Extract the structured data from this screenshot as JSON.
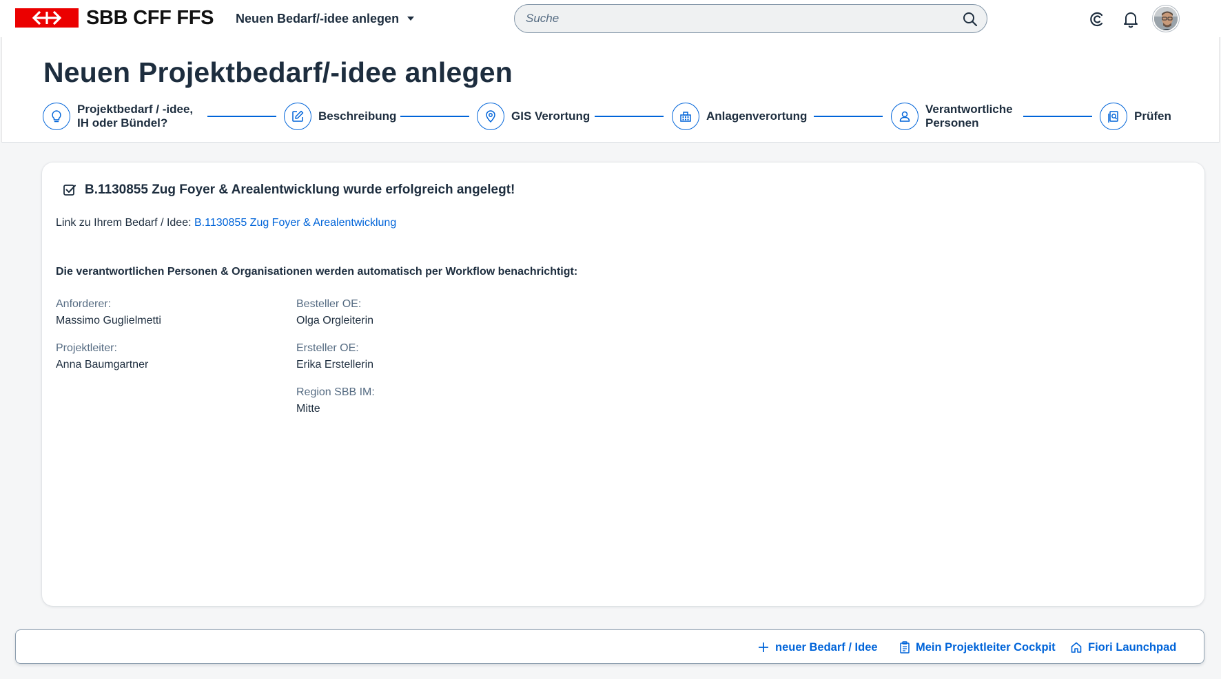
{
  "shell": {
    "brand": "SBB CFF FFS",
    "app_title": "Neuen Bedarf/-idee anlegen",
    "search_placeholder": "Suche"
  },
  "page": {
    "title": "Neuen Projektbedarf/-idee anlegen"
  },
  "wizard": {
    "steps": [
      {
        "label": "Projektbedarf / -idee,\nIH oder Bündel?",
        "icon": "lightbulb-icon"
      },
      {
        "label": "Beschreibung",
        "icon": "edit-icon"
      },
      {
        "label": "GIS Verortung",
        "icon": "map-pin-icon"
      },
      {
        "label": "Anlagenverortung",
        "icon": "building-icon"
      },
      {
        "label": "Verantwortliche\nPersonen",
        "icon": "person-icon"
      },
      {
        "label": "Prüfen",
        "icon": "review-icon"
      }
    ]
  },
  "result": {
    "success_message": "B.1130855 Zug Foyer & Arealentwicklung wurde erfolgreich angelegt!",
    "link_prefix": "Link zu Ihrem Bedarf / Idee: ",
    "link_text": "B.1130855 Zug Foyer & Arealentwicklung",
    "notify_title": "Die verantwortlichen Personen & Organisationen werden automatisch per Workflow benachrichtigt:",
    "fields": {
      "anforderer_label": "Anforderer:",
      "anforderer_value": "Massimo Guglielmetti",
      "projektleiter_label": "Projektleiter:",
      "projektleiter_value": "Anna Baumgartner",
      "besteller_label": "Besteller OE:",
      "besteller_value": "Olga Orgleiterin",
      "ersteller_label": "Ersteller OE:",
      "ersteller_value": "Erika Erstellerin",
      "region_label": "Region SBB IM:",
      "region_value": "Mitte"
    }
  },
  "footer": {
    "new_label": "neuer Bedarf / Idee",
    "cockpit_label": "Mein Projektleiter Cockpit",
    "launchpad_label": "Fiori Launchpad"
  },
  "colors": {
    "accent": "#0064d9",
    "brand_red": "#eb0000",
    "text": "#1d2d3e",
    "label": "#556b82"
  }
}
